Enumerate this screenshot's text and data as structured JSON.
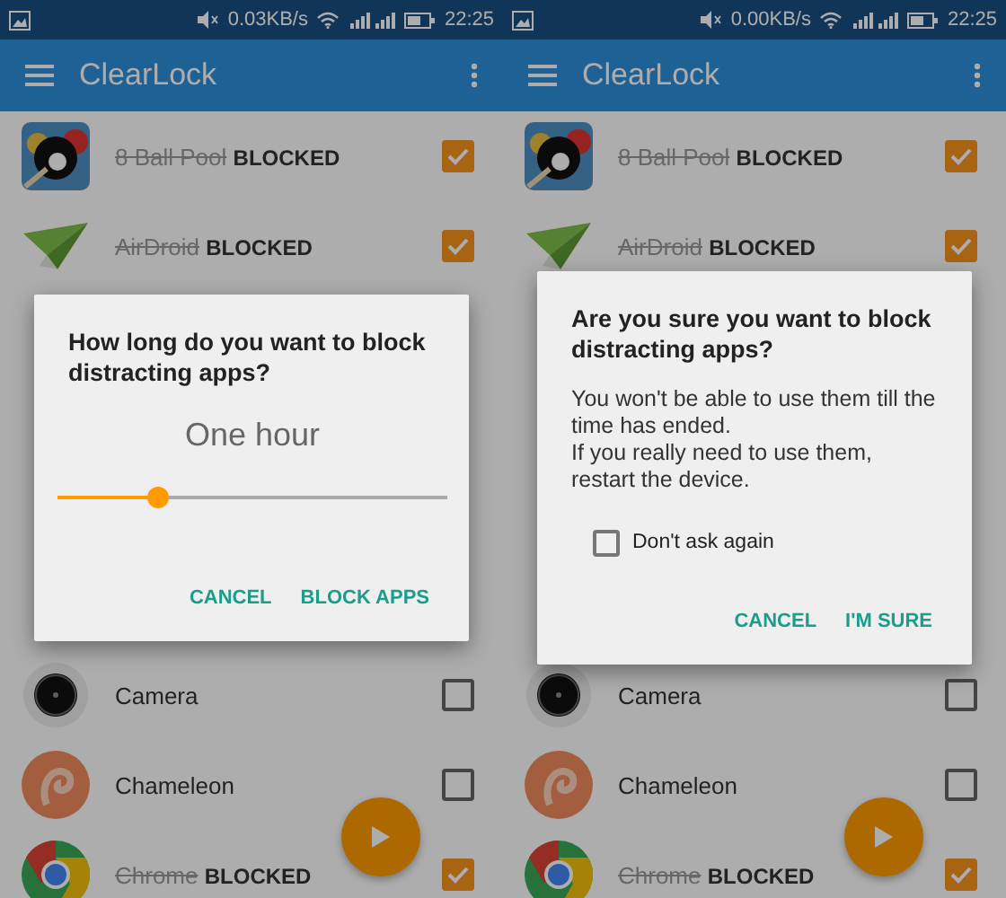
{
  "screens": [
    {
      "status_bar": {
        "speed": "0.03KB/s",
        "time": "22:25"
      },
      "app_bar": {
        "title": "ClearLock"
      },
      "rows_top": [
        {
          "name": "8 Ball Pool",
          "status": "BLOCKED",
          "checked": true
        },
        {
          "name": "AirDroid",
          "status": "BLOCKED",
          "checked": true
        }
      ],
      "rows_bottom": [
        {
          "name": "Camera",
          "checked": false
        },
        {
          "name": "Chameleon",
          "checked": false
        },
        {
          "name": "Chrome",
          "status": "BLOCKED",
          "checked": true
        }
      ],
      "dialog": {
        "kind": "slider",
        "title": "How long do you want to block distracting apps?",
        "value_label": "One hour",
        "level": 0.26,
        "buttons": [
          "CANCEL",
          "BLOCK APPS"
        ]
      }
    },
    {
      "status_bar": {
        "speed": "0.00KB/s",
        "time": "22:25"
      },
      "app_bar": {
        "title": "ClearLock"
      },
      "rows_top": [
        {
          "name": "8 Ball Pool",
          "status": "BLOCKED",
          "checked": true
        },
        {
          "name": "AirDroid",
          "status": "BLOCKED",
          "checked": true
        }
      ],
      "rows_bottom": [
        {
          "name": "Camera",
          "checked": false
        },
        {
          "name": "Chameleon",
          "checked": false
        },
        {
          "name": "Chrome",
          "status": "BLOCKED",
          "checked": true
        }
      ],
      "dialog": {
        "kind": "confirm",
        "title": "Are you sure you want to block distracting apps?",
        "message": "You won't be able to use them till the time has ended.\nIf you really need to use them, restart the device.",
        "checkbox": {
          "label": "Don't ask again",
          "checked": false
        },
        "buttons": [
          "CANCEL",
          "I'M SURE"
        ]
      }
    }
  ]
}
